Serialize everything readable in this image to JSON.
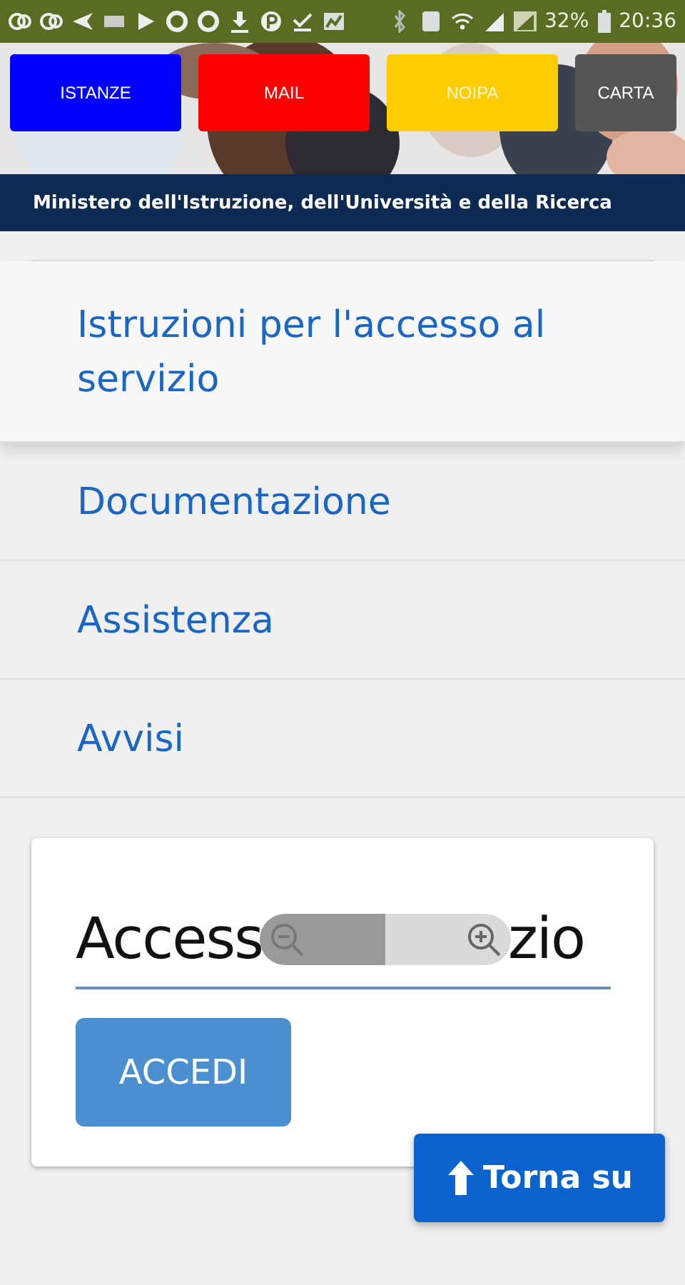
{
  "status_bar": {
    "battery": "32%",
    "time": "20:36"
  },
  "shortcuts": [
    {
      "label": "ISTANZE",
      "color": "#0000ff"
    },
    {
      "label": "MAIL",
      "color": "#ff0000"
    },
    {
      "label": "NOIPA",
      "color": "#ffcc00"
    },
    {
      "label": "CARTA",
      "color": "#555555"
    }
  ],
  "ministry_bar": {
    "title": "Ministero dell'Istruzione, dell'Università e della Ricerca"
  },
  "menu": {
    "items": [
      "Istruzioni per l'accesso al servizio",
      "Documentazione",
      "Assistenza",
      "Avvisi"
    ]
  },
  "login_card": {
    "heading_start": "Access",
    "heading_end": "zio",
    "button": "ACCEDI"
  },
  "back_to_top": {
    "label": "Torna su"
  }
}
